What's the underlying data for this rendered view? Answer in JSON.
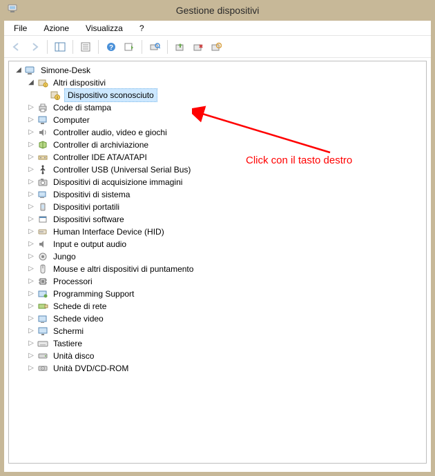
{
  "window": {
    "title": "Gestione dispositivi"
  },
  "menus": {
    "file": "File",
    "azione": "Azione",
    "visualizza": "Visualizza",
    "help": "?"
  },
  "tree": {
    "root": "Simone-Desk",
    "altri_dispositivi": "Altri dispositivi",
    "dispositivo_sconosciuto": "Dispositivo sconosciuto",
    "categories": [
      "Altri dispositivi",
      "Code di stampa",
      "Computer",
      "Controller audio, video e giochi",
      "Controller di archiviazione",
      "Controller IDE ATA/ATAPI",
      "Controller USB (Universal Serial Bus)",
      "Dispositivi di acquisizione immagini",
      "Dispositivi di sistema",
      "Dispositivi portatili",
      "Dispositivi software",
      "Human Interface Device (HID)",
      "Input e output audio",
      "Jungo",
      "Mouse e altri dispositivi di puntamento",
      "Processori",
      "Programming Support",
      "Schede di rete",
      "Schede video",
      "Schermi",
      "Tastiere",
      "Unità disco",
      "Unità DVD/CD-ROM"
    ]
  },
  "annotation": {
    "text": "Click con il tasto destro"
  },
  "icons": {
    "code_di_stampa": "printer-icon",
    "computer": "computer-icon",
    "controller_audio": "speaker-icon",
    "controller_archiviazione": "storage-icon",
    "controller_ide": "ide-icon",
    "controller_usb": "usb-icon",
    "acquisizione_immagini": "camera-icon",
    "dispositivi_sistema": "system-icon",
    "dispositivi_portatili": "portable-icon",
    "dispositivi_software": "software-icon",
    "hid": "hid-icon",
    "audio_io": "audio-io-icon",
    "jungo": "jungo-icon",
    "mouse": "mouse-icon",
    "processori": "cpu-icon",
    "programming": "programming-icon",
    "schede_rete": "network-icon",
    "schede_video": "video-card-icon",
    "schermi": "monitor-icon",
    "tastiere": "keyboard-icon",
    "unita_disco": "disk-icon",
    "unita_dvd": "dvd-icon"
  }
}
